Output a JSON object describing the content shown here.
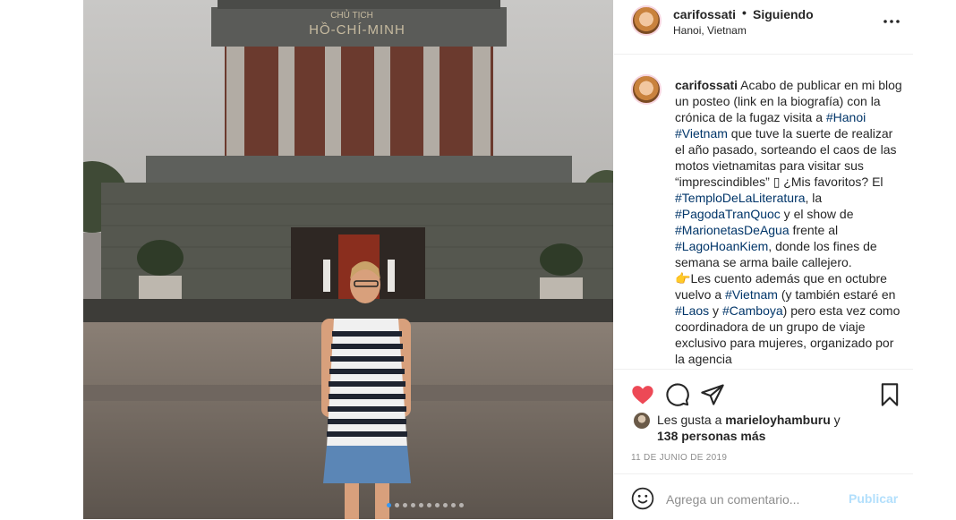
{
  "post": {
    "username": "carifossati",
    "separator": "•",
    "follow_status": "Siguiendo",
    "location": "Hanoi, Vietnam",
    "photo_sign_line1": "CHỦ TỊCH",
    "photo_sign_line2": "HỒ-CHÍ-MINH",
    "carousel_count": 10,
    "carousel_active_index": 0
  },
  "caption": {
    "username": "carifossati",
    "t1": " Acabo de publicar en mi blog un posteo (link en la biografía) con la crónica de la fugaz visita a ",
    "h1": "#Hanoi",
    "t2": " ",
    "h2": "#Vietnam",
    "t3": " que tuve la suerte de realizar el año pasado, sorteando el caos de las motos vietnamitas para visitar sus “imprescindibles” ▯ ¿Mis favoritos? El ",
    "h3": "#TemploDeLaLiteratura",
    "t4": ", la ",
    "h4": "#PagodaTranQuoc",
    "t5": " y el show de ",
    "h5": "#MarionetasDeAgua",
    "t6": " frente al ",
    "h6": "#LagoHoanKiem",
    "t7": ", donde los fines de semana se arma baile callejero.",
    "emoji_point": "👉",
    "t8": "Les cuento además que en octubre vuelvo a ",
    "h7": "#Vietnam",
    "t9": " (y también estaré en ",
    "h8": "#Laos",
    "t10": " y ",
    "h9": "#Camboya",
    "t11": ") pero esta vez como coordinadora de un grupo de viaje exclusivo para mujeres, organizado por la agencia"
  },
  "likes": {
    "prefix": "Les gusta a ",
    "user": "marieloyhamburu",
    "and": " y",
    "others": "138 personas más"
  },
  "date": "11 DE JUNIO DE 2019",
  "comment": {
    "placeholder": "Agrega un comentario...",
    "publish_label": "Publicar"
  },
  "colors": {
    "heart": "#ed4956",
    "hashtag": "#003569",
    "publish_disabled": "#b2dffc",
    "carousel_active": "#3897f0"
  },
  "icons": [
    "heart-icon",
    "comment-icon",
    "share-icon",
    "bookmark-icon",
    "more-icon",
    "emoji-icon",
    "chevron-right-icon"
  ]
}
